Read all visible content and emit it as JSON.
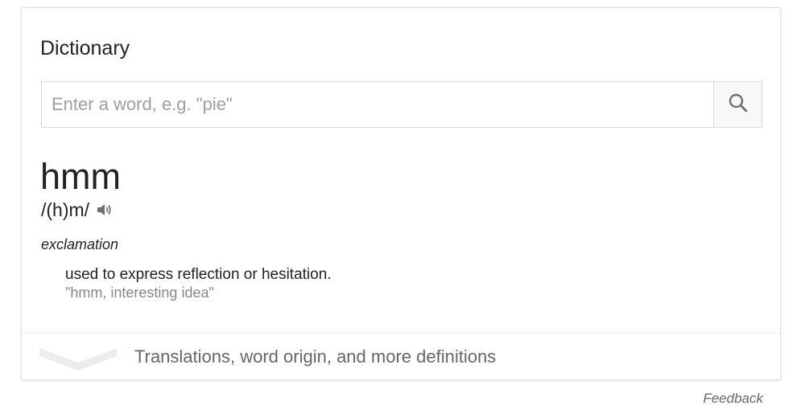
{
  "card": {
    "title": "Dictionary",
    "search": {
      "placeholder": "Enter a word, e.g. \"pie\"",
      "value": ""
    },
    "entry": {
      "word": "hmm",
      "pronunciation": "/(h)m/",
      "part_of_speech": "exclamation",
      "definition": "used to express reflection or hesitation.",
      "example": "\"hmm, interesting idea\""
    },
    "more_label": "Translations, word origin, and more definitions"
  },
  "footer": {
    "feedback_label": "Feedback"
  },
  "icons": {
    "search": "search-icon",
    "speaker": "speaker-icon",
    "expand": "chevron-down-icon"
  },
  "colors": {
    "text": "#222222",
    "muted": "#878787",
    "border": "#d9d9d9",
    "icon": "#707070"
  }
}
